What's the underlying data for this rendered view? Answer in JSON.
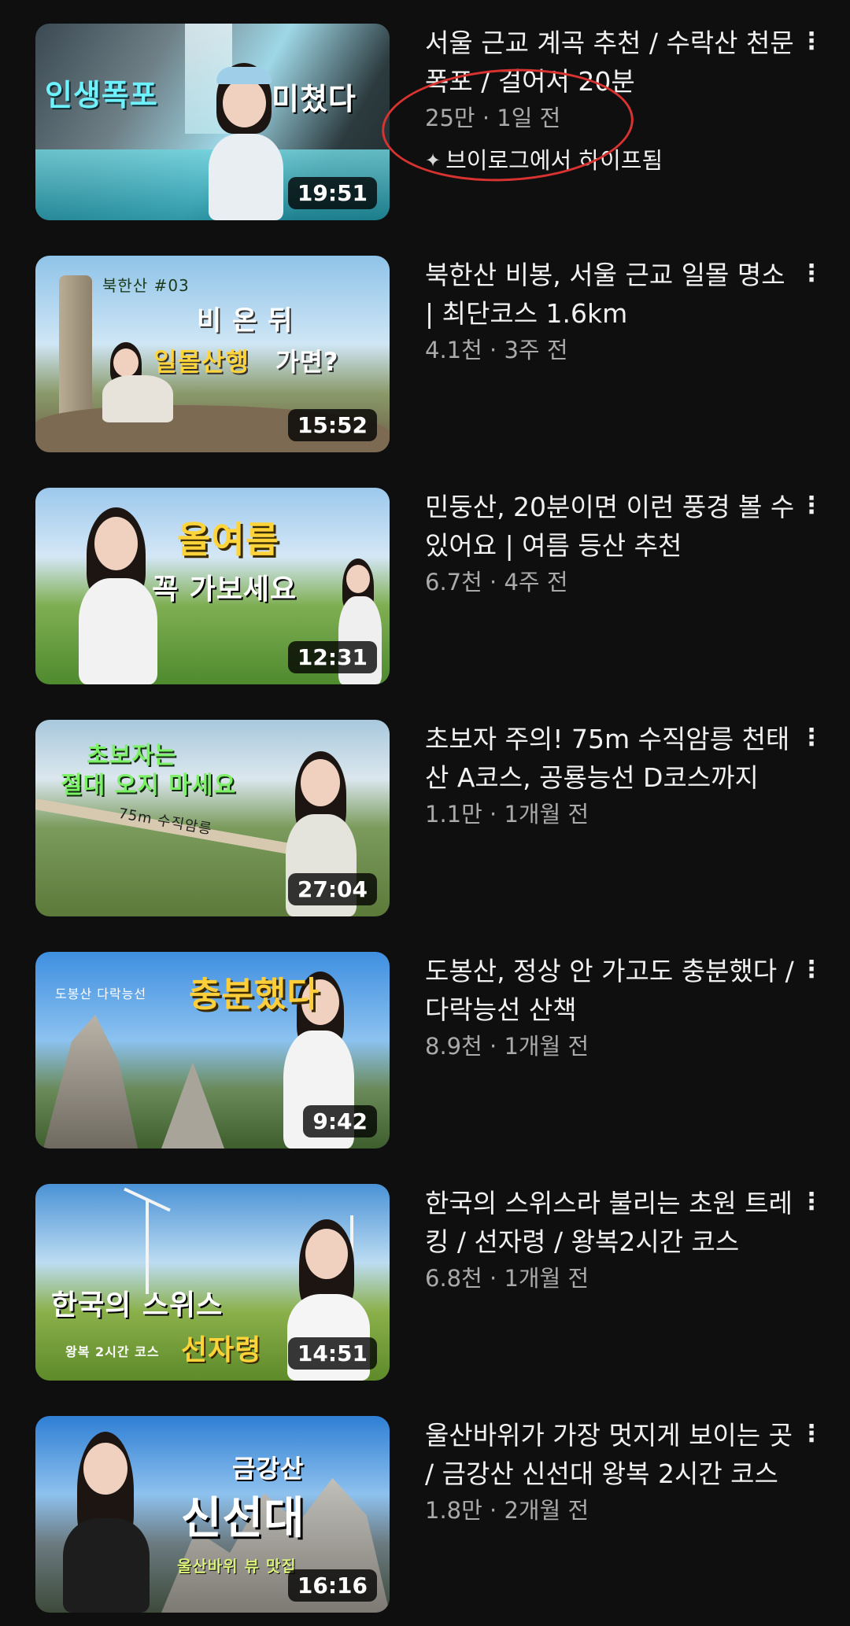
{
  "videos": [
    {
      "title": "서울 근교 계곡 추천 / 수락산 천문폭포 / 걸어서 20분",
      "views": "25만",
      "age": "1일 전",
      "badge": "브이로그에서 하이프됨",
      "duration": "19:51",
      "overlay": [
        "인생폭포",
        "미쳤다"
      ]
    },
    {
      "title": "북한산 비봉, 서울 근교 일몰 명소 | 최단코스 1.6km",
      "views": "4.1천",
      "age": "3주 전",
      "duration": "15:52",
      "overlay": [
        "북한산 #03",
        "비 온 뒤",
        "일몰산행",
        "가면?"
      ]
    },
    {
      "title": "민둥산, 20분이면 이런 풍경 볼 수 있어요 | 여름 등산 추천",
      "views": "6.7천",
      "age": "4주 전",
      "duration": "12:31",
      "overlay": [
        "올여름",
        "꼭 가보세요"
      ]
    },
    {
      "title": "초보자 주의! 75m 수직암릉 천태산 A코스, 공룡능선 D코스까지",
      "views": "1.1만",
      "age": "1개월 전",
      "duration": "27:04",
      "overlay": [
        "초보자는",
        "절대 오지 마세요",
        "75m 수직암릉"
      ]
    },
    {
      "title": "도봉산, 정상 안 가고도 충분했다 / 다락능선 산책",
      "views": "8.9천",
      "age": "1개월 전",
      "duration": "9:42",
      "overlay": [
        "도봉산 다락능선",
        "충분했다"
      ]
    },
    {
      "title": "한국의 스위스라 불리는 초원 트레킹 / 선자령 / 왕복2시간 코스",
      "views": "6.8천",
      "age": "1개월 전",
      "duration": "14:51",
      "overlay": [
        "한국의 스위스",
        "왕복 2시간 코스",
        "선자령"
      ]
    },
    {
      "title": "울산바위가 가장 멋지게 보이는 곳 / 금강산 신선대 왕복 2시간 코스",
      "views": "1.8만",
      "age": "2개월 전",
      "duration": "16:16",
      "overlay": [
        "금강산",
        "신선대",
        "울산바위 뷰 맛집"
      ]
    }
  ],
  "meta_separator": "·",
  "icons": {
    "more": "vertical-more-icon",
    "sparkle": "sparkle-icon"
  },
  "colors": {
    "background": "#0f0f0f",
    "primary_text": "#f1f1f1",
    "secondary_text": "#aaaaaa",
    "annotation": "#d83330"
  }
}
